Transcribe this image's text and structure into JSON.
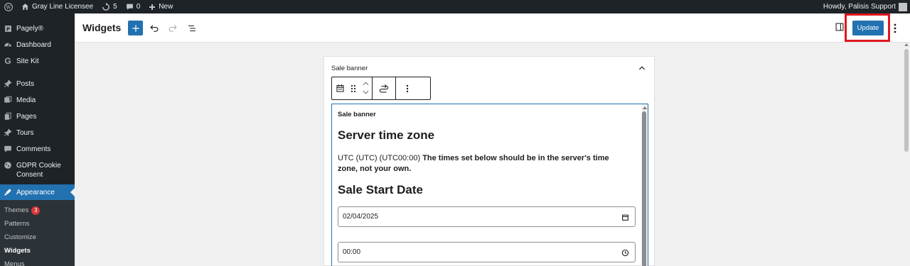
{
  "admin_bar": {
    "wp_logo": "wordpress-icon",
    "site_name": "Gray Line Licensee",
    "updates_count": "5",
    "comments_count": "0",
    "new_label": "New",
    "howdy": "Howdy, Palisis Support"
  },
  "sidebar": {
    "items": [
      {
        "label": "Pagely®",
        "icon": "pagely-icon"
      },
      {
        "label": "Dashboard",
        "icon": "dashboard-icon"
      },
      {
        "label": "Site Kit",
        "icon": "sitekit-icon"
      },
      {
        "label": "Posts",
        "icon": "pin-icon"
      },
      {
        "label": "Media",
        "icon": "media-icon"
      },
      {
        "label": "Pages",
        "icon": "pages-icon"
      },
      {
        "label": "Tours",
        "icon": "pin-icon"
      },
      {
        "label": "Comments",
        "icon": "comment-icon"
      },
      {
        "label": "GDPR Cookie Consent",
        "icon": "cookie-icon"
      },
      {
        "label": "Appearance",
        "icon": "brush-icon"
      }
    ],
    "submenu": [
      {
        "label": "Themes",
        "badge": "3"
      },
      {
        "label": "Patterns"
      },
      {
        "label": "Customize"
      },
      {
        "label": "Widgets"
      },
      {
        "label": "Menus"
      }
    ]
  },
  "header": {
    "title": "Widgets",
    "update_label": "Update"
  },
  "widget_area": {
    "title": "Sale banner"
  },
  "block": {
    "heading": "Sale banner",
    "timezone_heading": "Server time zone",
    "timezone_value": "UTC (UTC) (UTC00:00)",
    "timezone_note": "The times set below should be in the server's time zone, not your own.",
    "sale_start_heading": "Sale Start Date",
    "date_value": "02/04/2025",
    "time_value": "00:00"
  },
  "colors": {
    "accent": "#2271b1",
    "admin_dark": "#1d2327",
    "highlight_red": "#e0171d",
    "badge_red": "#d63638"
  }
}
